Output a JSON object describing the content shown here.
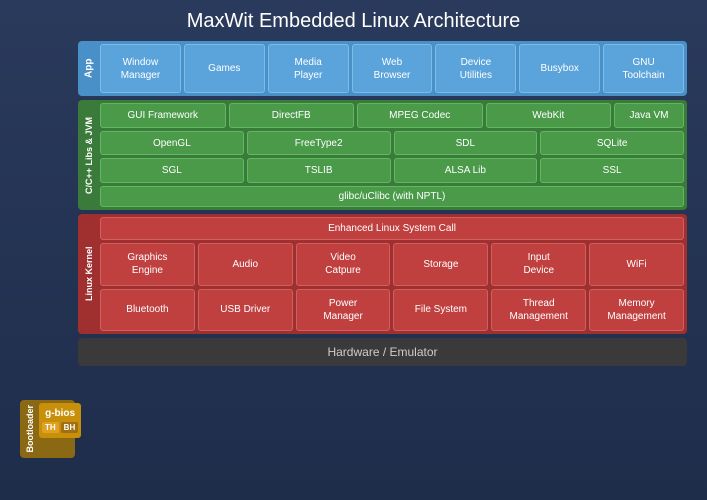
{
  "title": "MaxWit Embedded Linux Architecture",
  "app_layer": {
    "label": "App",
    "cells": [
      {
        "text": "Window Manager"
      },
      {
        "text": "Games"
      },
      {
        "text": "Media Player"
      },
      {
        "text": "Web Browser"
      },
      {
        "text": "Device Utilities"
      },
      {
        "text": "Busybox"
      },
      {
        "text": "GNU Toolchain"
      }
    ]
  },
  "libs_layer": {
    "label": "C/C++ Libs & JVM",
    "rows": [
      [
        {
          "text": "GUI Framework"
        },
        {
          "text": "DirectFB"
        },
        {
          "text": "MPEG Codec"
        },
        {
          "text": "WebKit"
        }
      ],
      [
        {
          "text": "OpenGL"
        },
        {
          "text": "FreeType2"
        },
        {
          "text": "SDL"
        },
        {
          "text": "SQLite"
        }
      ],
      [
        {
          "text": "SGL"
        },
        {
          "text": "TSLIB"
        },
        {
          "text": "ALSA Lib"
        },
        {
          "text": "SSL"
        }
      ]
    ],
    "java_vm": "Java VM",
    "glibc": "glibc/uClibc (with NPTL)"
  },
  "kernel_layer": {
    "label": "Linux Kernel",
    "enhanced": "Enhanced Linux System Call",
    "rows": [
      [
        {
          "text": "Graphics Engine"
        },
        {
          "text": "Audio"
        },
        {
          "text": "Video Catpure"
        },
        {
          "text": "Storage"
        },
        {
          "text": "Input Device"
        },
        {
          "text": "WiFi"
        }
      ],
      [
        {
          "text": "Bluetooth"
        },
        {
          "text": "USB Driver"
        },
        {
          "text": "Power Manager"
        },
        {
          "text": "File System"
        },
        {
          "text": "Thread Management"
        },
        {
          "text": "Memory Management"
        }
      ]
    ]
  },
  "hardware_layer": {
    "text": "Hardware / Emulator"
  },
  "bootloader": {
    "label": "Bootloader",
    "gbios_label": "g-bios",
    "th_tag": "TH",
    "bh_tag": "BH"
  }
}
